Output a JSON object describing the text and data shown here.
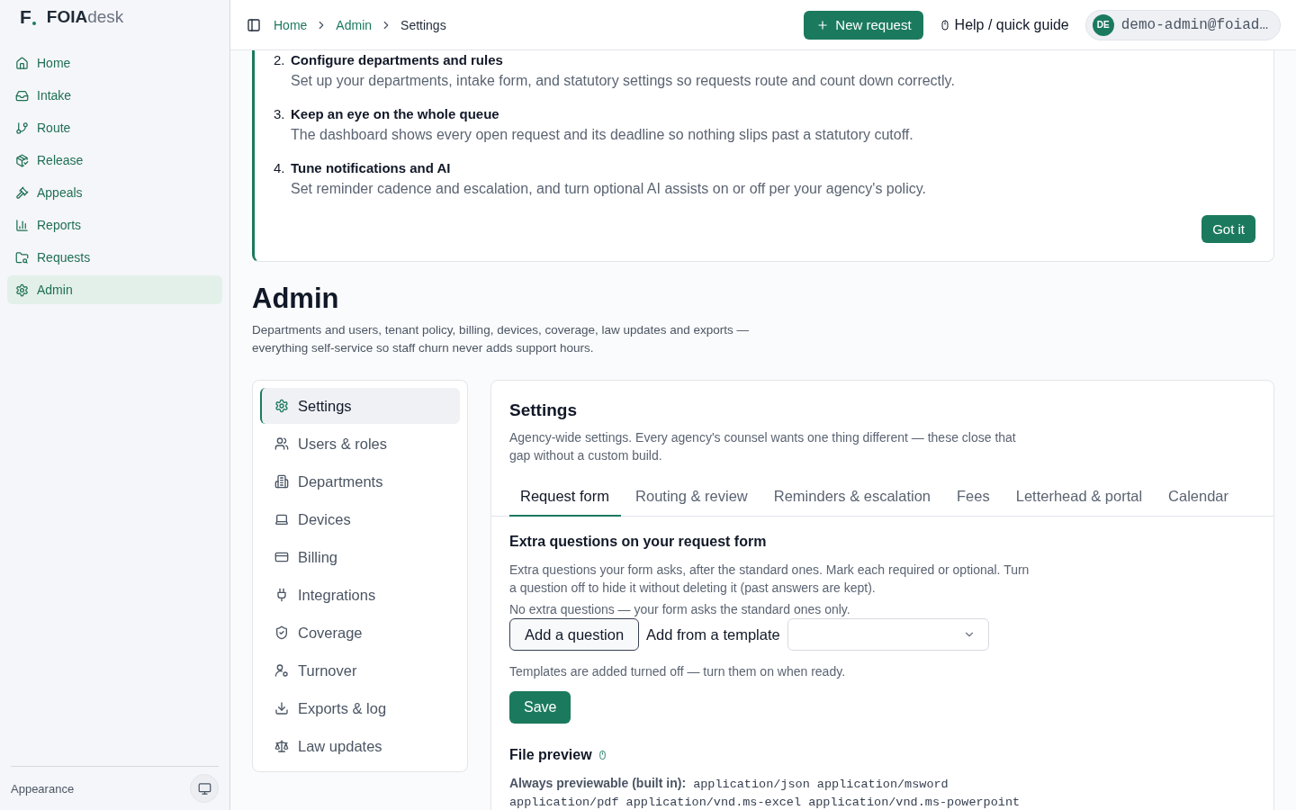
{
  "sidebar": {
    "logo": {
      "mark": "F",
      "name": "**FOIA**desk"
    },
    "items": [
      {
        "label": "Home",
        "selected": false
      },
      {
        "label": "Intake",
        "selected": false
      },
      {
        "label": "Route",
        "selected": false
      },
      {
        "label": "Release",
        "selected": false
      },
      {
        "label": "Appeals",
        "selected": false
      },
      {
        "label": "Reports",
        "selected": false
      },
      {
        "label": "Requests",
        "selected": false
      },
      {
        "label": "Admin",
        "selected": true
      }
    ],
    "footer": {
      "label": "Appearance"
    }
  },
  "topbar": {
    "breadcrumb": [
      {
        "label": "Home",
        "current": false
      },
      {
        "label": "Admin",
        "current": false
      },
      {
        "label": "Settings",
        "current": true
      }
    ],
    "new_request": "New request",
    "help": "Help / quick guide",
    "user": {
      "initials": "DE",
      "email": "demo-admin@foiad…"
    }
  },
  "guide": {
    "steps": [
      {
        "number": "2.",
        "title": "Configure departments and rules",
        "text": "Set up your departments, intake form, and statutory settings so requests route and count down correctly."
      },
      {
        "number": "3.",
        "title": "Keep an eye on the whole queue",
        "text": "The dashboard shows every open request and its deadline so nothing slips past a statutory cutoff."
      },
      {
        "number": "4.",
        "title": "Tune notifications and AI",
        "text": "Set reminder cadence and escalation, and turn optional AI assists on or off per your agency's policy."
      }
    ],
    "button": "Got it"
  },
  "header": {
    "title": "Admin",
    "description": "Departments and users, tenant policy, billing, devices, coverage, law updates and exports — everything self-service so staff churn never adds support hours."
  },
  "admin_nav": {
    "items": [
      {
        "label": "Settings",
        "selected": true
      },
      {
        "label": "Users & roles",
        "selected": false
      },
      {
        "label": "Departments",
        "selected": false
      },
      {
        "label": "Devices",
        "selected": false
      },
      {
        "label": "Billing",
        "selected": false
      },
      {
        "label": "Integrations",
        "selected": false
      },
      {
        "label": "Coverage",
        "selected": false
      },
      {
        "label": "Turnover",
        "selected": false
      },
      {
        "label": "Exports & log",
        "selected": false
      },
      {
        "label": "Law updates",
        "selected": false
      }
    ]
  },
  "settings": {
    "title": "Settings",
    "description": "Agency-wide settings. Every agency's counsel wants one thing different — these close that gap without a custom build.",
    "tabs": [
      {
        "label": "Request form",
        "selected": true
      },
      {
        "label": "Routing & review",
        "selected": false
      },
      {
        "label": "Reminders & escalation",
        "selected": false
      },
      {
        "label": "Fees",
        "selected": false
      },
      {
        "label": "Letterhead & portal",
        "selected": false
      },
      {
        "label": "Calendar",
        "selected": false
      }
    ],
    "extra_questions": {
      "title": "Extra questions on your request form",
      "description": "Extra questions your form asks, after the standard ones. Mark each required or optional. Turn a question off to hide it without deleting it (past answers are kept).",
      "empty_note": "No extra questions — your form asks the standard ones only.",
      "add_button": "Add a question",
      "template_label": "Add from a template",
      "hint": "Templates are added turned off — turn them on when ready.",
      "save": "Save"
    },
    "file_preview": {
      "title": "File preview",
      "builtin": "**Always previewable (built in):** application/json application/msword application/pdf application/vnd.ms-excel application/vnd.ms-powerpoint"
    }
  }
}
